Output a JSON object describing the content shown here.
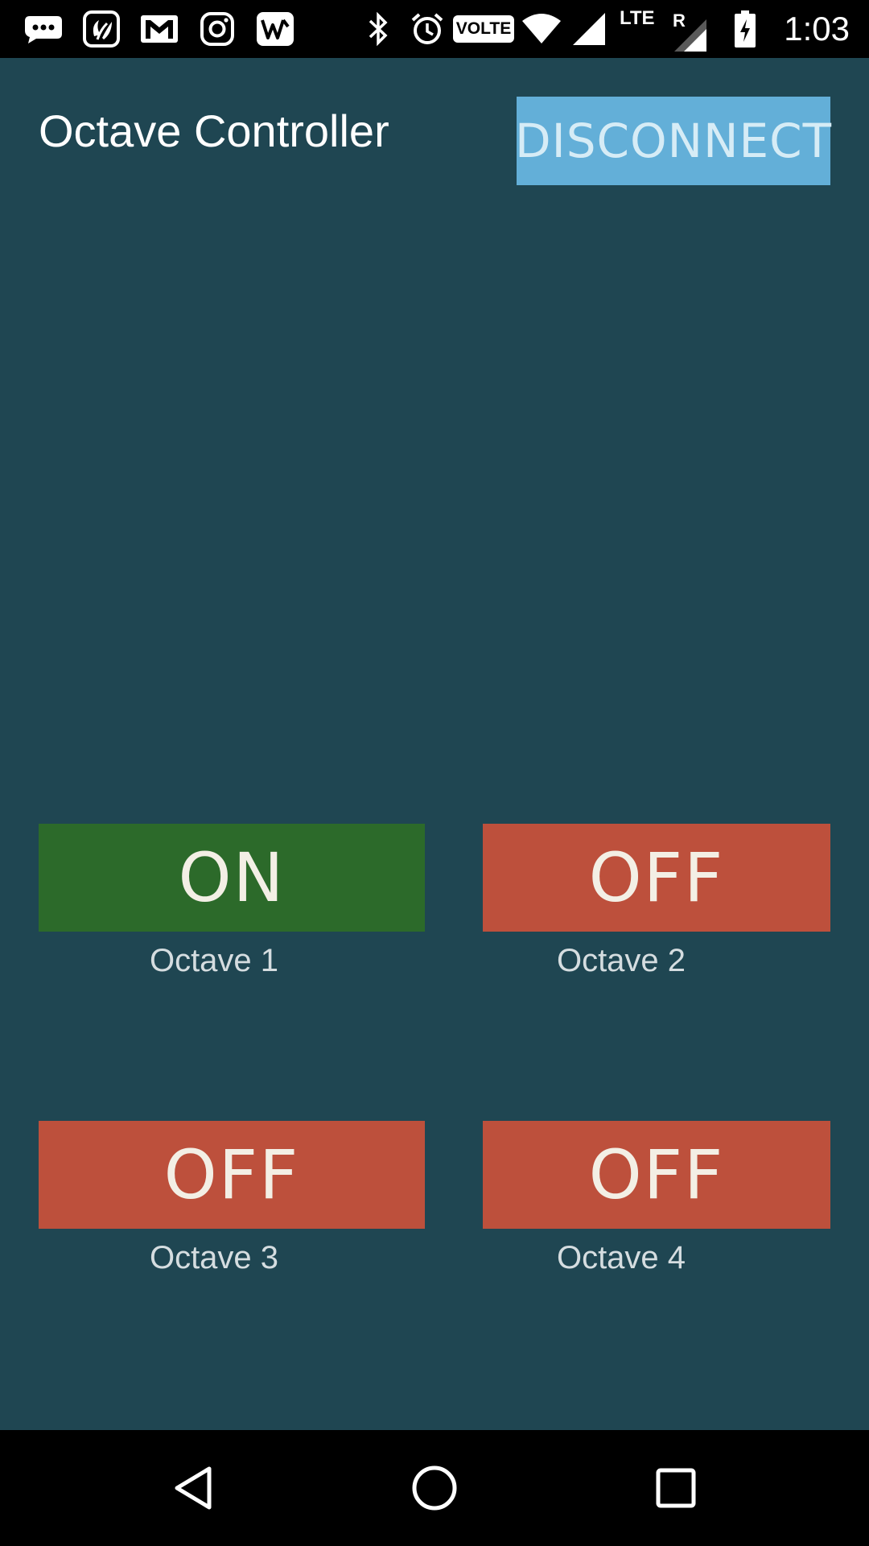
{
  "status_bar": {
    "time": "1:03",
    "left_icons": [
      "message-icon",
      "saavn-icon",
      "gmail-icon",
      "instagram-icon",
      "wattpad-icon"
    ],
    "right_icons": [
      "bluetooth-icon",
      "alarm-icon",
      "volte-icon",
      "wifi-icon",
      "signal-icon",
      "lte-roaming-signal-icon",
      "battery-charging-icon"
    ],
    "volte_label": "VOLTE",
    "lte_label": "LTE",
    "roaming_label": "R"
  },
  "app": {
    "title": "Octave Controller",
    "disconnect_label": "DISCONNECT",
    "background_color": "#1f4652",
    "octaves": [
      {
        "label": "Octave 1",
        "state": "ON",
        "color": "#2c6a2a"
      },
      {
        "label": "Octave 2",
        "state": "OFF",
        "color": "#bd503c"
      },
      {
        "label": "Octave 3",
        "state": "OFF",
        "color": "#bd503c"
      },
      {
        "label": "Octave 4",
        "state": "OFF",
        "color": "#bd503c"
      }
    ]
  },
  "nav_bar": {
    "icons": [
      "back-icon",
      "home-icon",
      "recents-icon"
    ]
  }
}
